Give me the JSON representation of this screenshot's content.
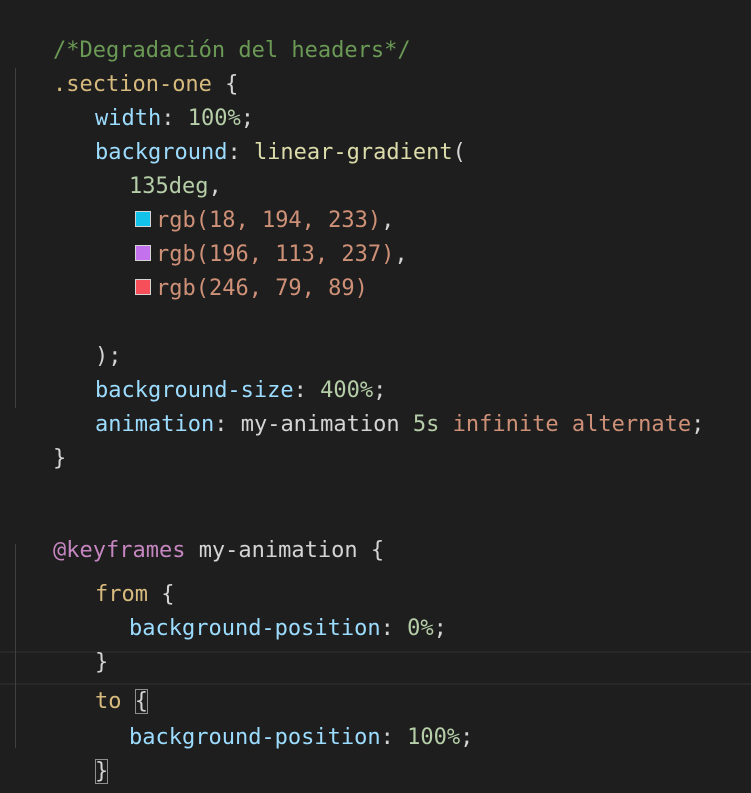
{
  "colors": {
    "background": "#1e1e1e",
    "comment": "#6a9955",
    "selector": "#d7ba7d",
    "property": "#9cdcfe",
    "number": "#b5cea8",
    "value": "#ce9178",
    "punctuation": "#d4d4d4",
    "at_keyword": "#c586c0",
    "function": "#dcdcaa"
  },
  "code": {
    "comment": "/*Degradación del headers*/",
    "selector": ".section-one",
    "open_brace": " {",
    "width_prop": "width",
    "width_val": "100%",
    "bg_prop": "background",
    "bg_func": "linear-gradient",
    "open_paren": "(",
    "angle": "135deg",
    "color1": "rgb(18, 194, 233)",
    "color1_hex": "#12c2e9",
    "color2": "rgb(196, 113, 237)",
    "color2_hex": "#c471ed",
    "color3": "rgb(246, 79, 89)",
    "color3_hex": "#f64f59",
    "close_paren": ");",
    "bgsize_prop": "background-size",
    "bgsize_val": "400%",
    "anim_prop": "animation",
    "anim_name": "my-animation",
    "anim_duration": "5s",
    "anim_count": "infinite",
    "anim_direction": "alternate",
    "close_brace": "}",
    "keyframes_kw": "@keyframes",
    "keyframes_name": "my-animation",
    "from_kw": "from",
    "bgpos_prop": "background-position",
    "bgpos_from": "0%",
    "to_kw": "to",
    "bgpos_to": "100%",
    "colon": ": ",
    "semicolon": ";",
    "comma": ",",
    "brace_open": "{"
  }
}
